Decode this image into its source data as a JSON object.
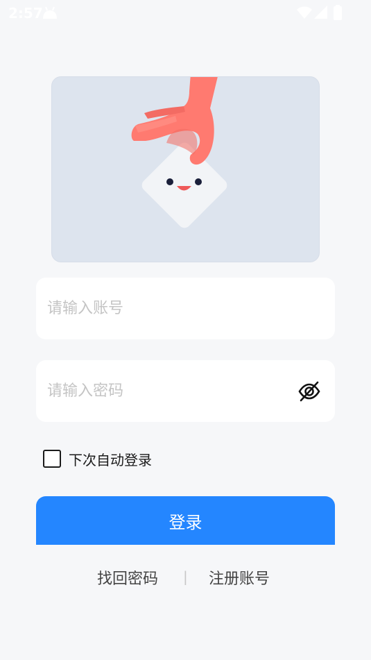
{
  "status_bar": {
    "time": "2:57",
    "icons": [
      "android-icon",
      "wifi-icon",
      "signal-icon",
      "battery-icon"
    ]
  },
  "hero": {
    "illustration": "hand-holding-card-illustration",
    "colors": {
      "background": "#dde4ee",
      "hand": "#ff7a70",
      "card": "#f2f4f7",
      "eyes": "#1a1f3a",
      "mouth": "#ef5a5a"
    }
  },
  "account_field": {
    "placeholder": "请输入账号",
    "value": ""
  },
  "password_field": {
    "placeholder": "请输入密码",
    "value": "",
    "toggle_icon": "eye-off-icon"
  },
  "remember": {
    "label": "下次自动登录",
    "checked": false
  },
  "login_button": {
    "label": "登录",
    "color": "#2486ff"
  },
  "links": {
    "forgot_password": "找回密码",
    "divider": "|",
    "register": "注册账号"
  }
}
